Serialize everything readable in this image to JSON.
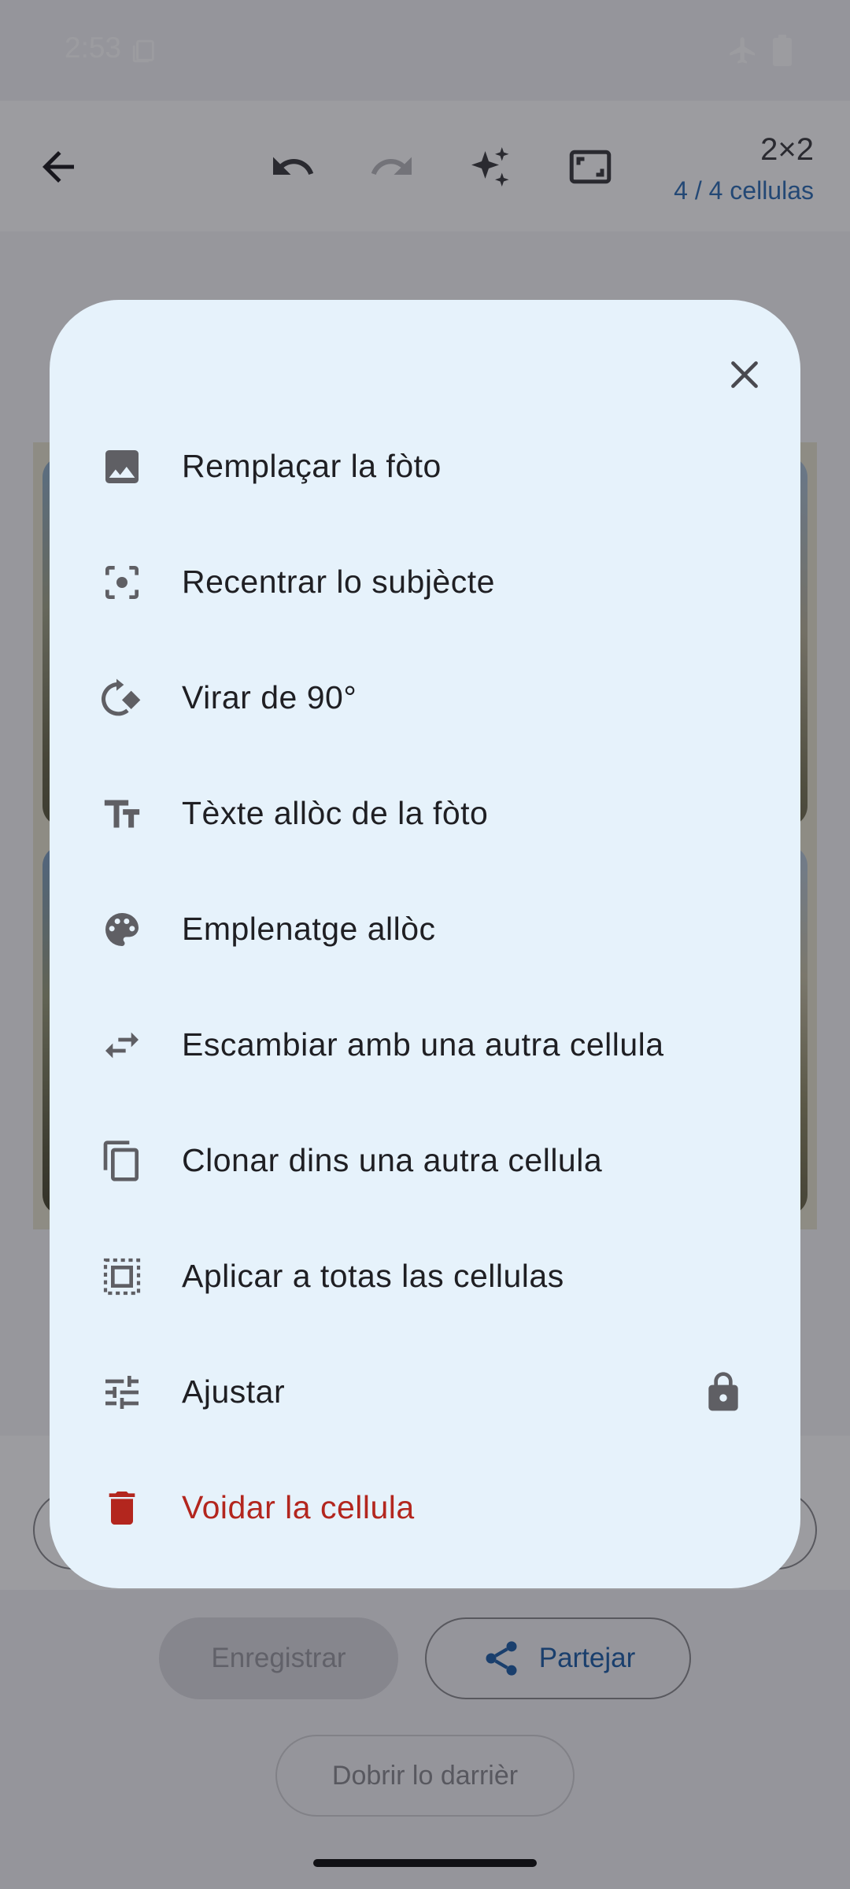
{
  "status": {
    "time": "2:53"
  },
  "toolbar": {
    "grid_size": "2×2",
    "cell_count": "4 / 4 cellulas"
  },
  "dialog": {
    "items": [
      {
        "label": "Remplaçar la fòto",
        "icon": "image-icon"
      },
      {
        "label": "Recentrar lo subjècte",
        "icon": "center-focus-icon"
      },
      {
        "label": "Virar de 90°",
        "icon": "rotate-icon"
      },
      {
        "label": "Tèxte allòc de la fòto",
        "icon": "text-icon"
      },
      {
        "label": "Emplenatge allòc",
        "icon": "palette-icon"
      },
      {
        "label": "Escambiar amb una autra cellula",
        "icon": "swap-icon"
      },
      {
        "label": "Clonar dins una autra cellula",
        "icon": "copy-icon"
      },
      {
        "label": "Aplicar a totas las cellulas",
        "icon": "select-all-icon"
      },
      {
        "label": "Ajustar",
        "icon": "tune-icon",
        "locked": true
      },
      {
        "label": "Voidar la cellula",
        "icon": "delete-icon",
        "danger": true
      }
    ]
  },
  "bottom": {
    "save_label": "Enregistrar",
    "share_label": "Partejar",
    "reopen_label": "Dobrir lo darrièr"
  },
  "colors": {
    "accent": "#2f6fb6",
    "danger": "#b3261e",
    "dialog_bg": "#e6f2fb"
  }
}
